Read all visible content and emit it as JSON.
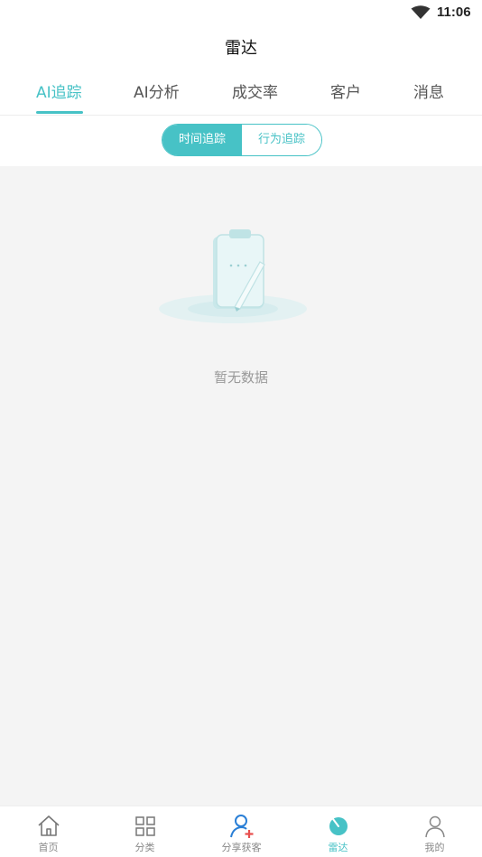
{
  "status": {
    "time": "11:06"
  },
  "header": {
    "title": "雷达"
  },
  "tabs": [
    {
      "label": "AI追踪",
      "active": true
    },
    {
      "label": "AI分析",
      "active": false
    },
    {
      "label": "成交率",
      "active": false
    },
    {
      "label": "客户",
      "active": false
    },
    {
      "label": "消息",
      "active": false
    }
  ],
  "segment": {
    "time_label": "时间追踪",
    "behavior_label": "行为追踪",
    "selected": "时间追踪"
  },
  "empty": {
    "text": "暂无数据",
    "icon": "empty-clipboard-icon"
  },
  "bottom_nav": [
    {
      "label": "首页",
      "icon": "home-icon"
    },
    {
      "label": "分类",
      "icon": "grid-icon"
    },
    {
      "label": "分享获客",
      "icon": "add-user-icon"
    },
    {
      "label": "雷达",
      "icon": "radar-icon",
      "active": true
    },
    {
      "label": "我的",
      "icon": "user-icon"
    }
  ],
  "colors": {
    "accent": "#47c2c6",
    "background": "#f4f4f4",
    "add_badge": "#e8504f",
    "share_icon": "#2a7fd6"
  }
}
